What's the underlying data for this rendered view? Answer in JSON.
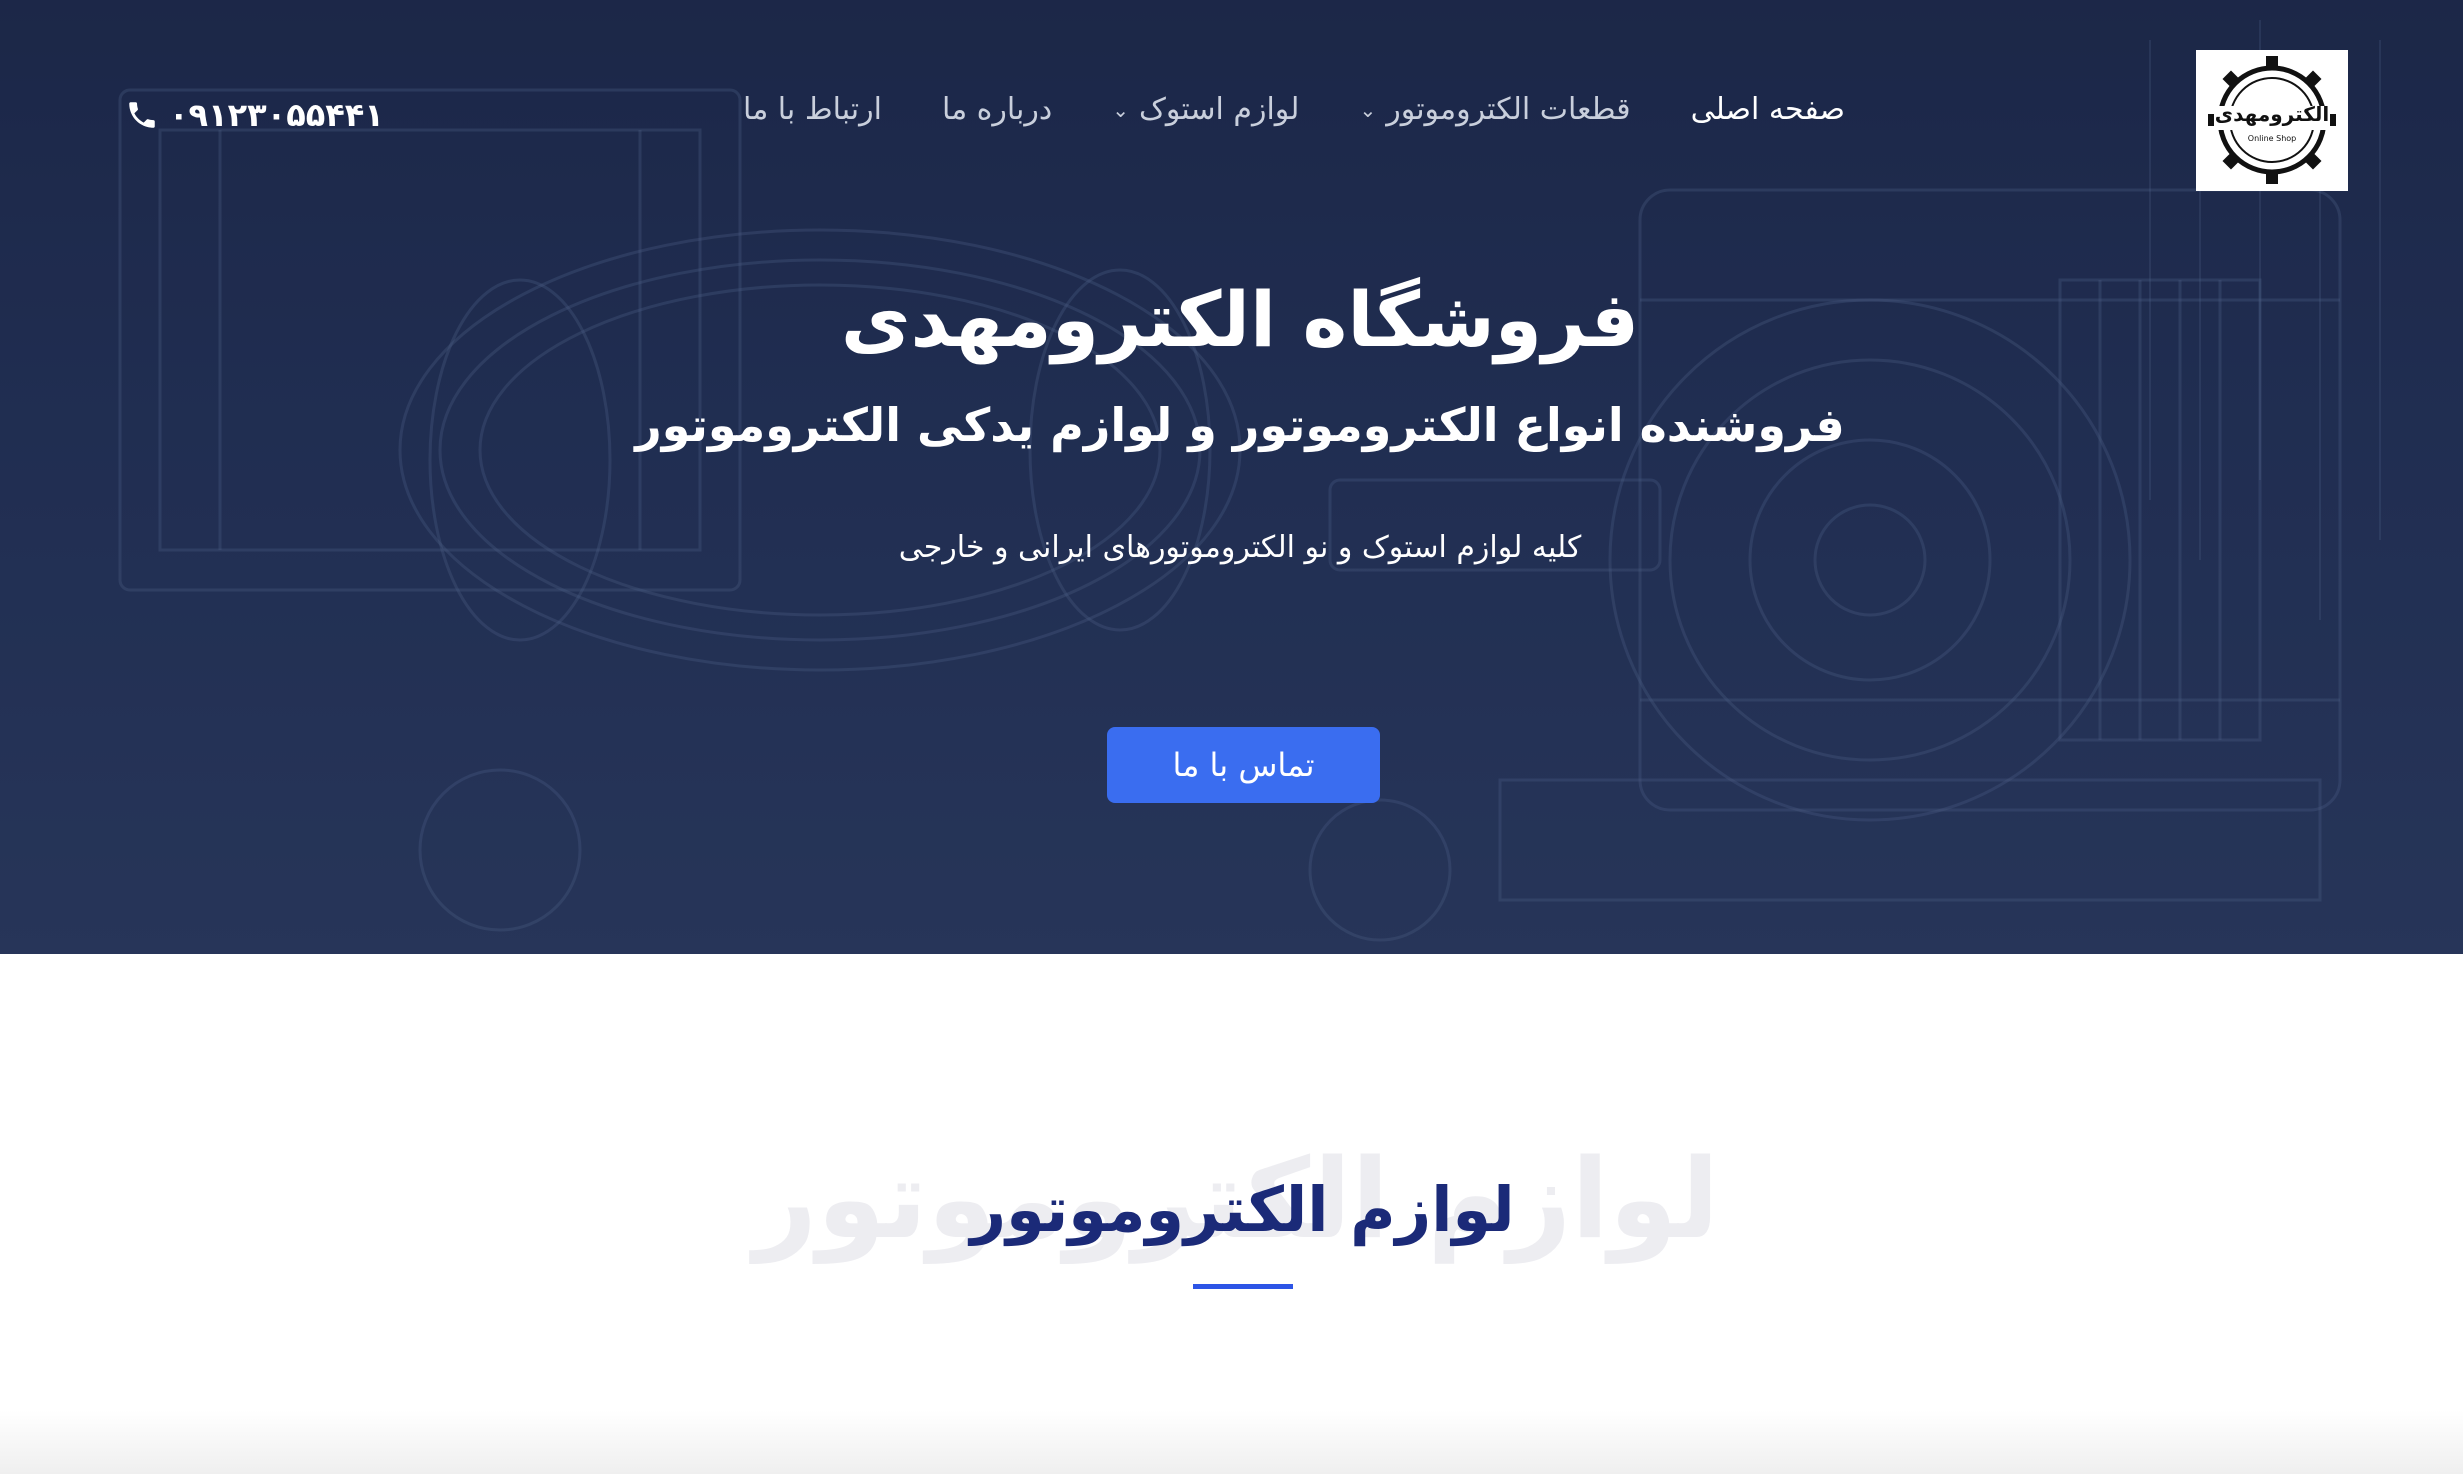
{
  "header": {
    "logo": {
      "main_text": "الکترومهدی",
      "sub_text": "Online Shop"
    },
    "nav": [
      {
        "label": "صفحه اصلی",
        "active": true,
        "has_dropdown": false
      },
      {
        "label": "قطعات الکتروموتور",
        "active": false,
        "has_dropdown": true
      },
      {
        "label": "لوازم استوک",
        "active": false,
        "has_dropdown": true
      },
      {
        "label": "درباره ما",
        "active": false,
        "has_dropdown": false
      },
      {
        "label": "ارتباط با ما",
        "active": false,
        "has_dropdown": false
      }
    ],
    "phone": "۰۹۱۲۳۰۵۵۴۴۱"
  },
  "hero": {
    "title": "فروشگاه الکترومهدی",
    "subtitle": "فروشنده انواع الکتروموتور و لوازم یدکی الکتروموتور",
    "description": "کلیه لوازم استوک و نو الکتروموتورهای ایرانی و خارجی",
    "cta_label": "تماس با ما"
  },
  "section": {
    "ghost_title": "لوازم الکتروموتور",
    "title": "لوازم الکتروموتور"
  },
  "icons": {
    "phone": "phone-icon",
    "chevron": "chevron-down-icon",
    "logo": "gear-logo"
  },
  "colors": {
    "hero_bg": "#223055",
    "accent": "#3a6df0",
    "section_title": "#1b2a78",
    "underline": "#2d55e6"
  }
}
